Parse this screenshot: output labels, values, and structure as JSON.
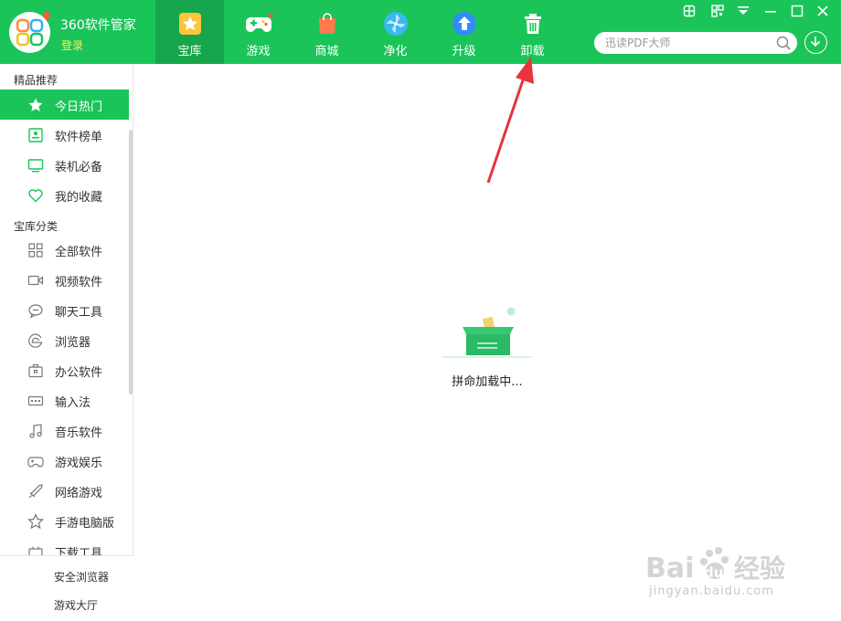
{
  "app": {
    "title": "360软件管家",
    "login_label": "登录"
  },
  "tabs": [
    {
      "label": "宝库",
      "icon": "star-badge-icon",
      "active": true
    },
    {
      "label": "游戏",
      "icon": "gamepad-icon",
      "active": false
    },
    {
      "label": "商城",
      "icon": "shopping-bag-icon",
      "active": false
    },
    {
      "label": "净化",
      "icon": "clean-fan-icon",
      "active": false
    },
    {
      "label": "升级",
      "icon": "upgrade-arrow-icon",
      "active": false
    },
    {
      "label": "卸载",
      "icon": "trash-icon",
      "active": false
    }
  ],
  "search": {
    "placeholder": "迅读PDF大师"
  },
  "sidebar": {
    "featured_title": "精品推荐",
    "featured_items": [
      {
        "label": "今日热门",
        "icon": "star-icon",
        "active": true
      },
      {
        "label": "软件榜单",
        "icon": "ranking-icon",
        "active": false
      },
      {
        "label": "装机必备",
        "icon": "monitor-icon",
        "active": false
      },
      {
        "label": "我的收藏",
        "icon": "heart-icon",
        "active": false
      }
    ],
    "category_title": "宝库分类",
    "category_items": [
      {
        "label": "全部软件",
        "icon": "grid-icon"
      },
      {
        "label": "视频软件",
        "icon": "video-icon"
      },
      {
        "label": "聊天工具",
        "icon": "chat-icon"
      },
      {
        "label": "浏览器",
        "icon": "browser-icon"
      },
      {
        "label": "办公软件",
        "icon": "briefcase-icon"
      },
      {
        "label": "输入法",
        "icon": "keyboard-icon"
      },
      {
        "label": "音乐软件",
        "icon": "music-icon"
      },
      {
        "label": "游戏娱乐",
        "icon": "gamepad-outline-icon"
      },
      {
        "label": "网络游戏",
        "icon": "sword-icon"
      },
      {
        "label": "手游电脑版",
        "icon": "star-outline-icon"
      },
      {
        "label": "下载工具",
        "icon": "download-tool-icon"
      }
    ],
    "bottom_links": [
      "安全浏览器",
      "游戏大厅"
    ]
  },
  "main": {
    "loading_text": "拼命加载中..."
  },
  "watermark": {
    "brand": "Bai 经验",
    "url": "jingyan.baidu.com"
  },
  "colors": {
    "brand_green": "#1bc459",
    "active_tab": "#17a64b",
    "annotation_arrow": "#e8343a"
  }
}
